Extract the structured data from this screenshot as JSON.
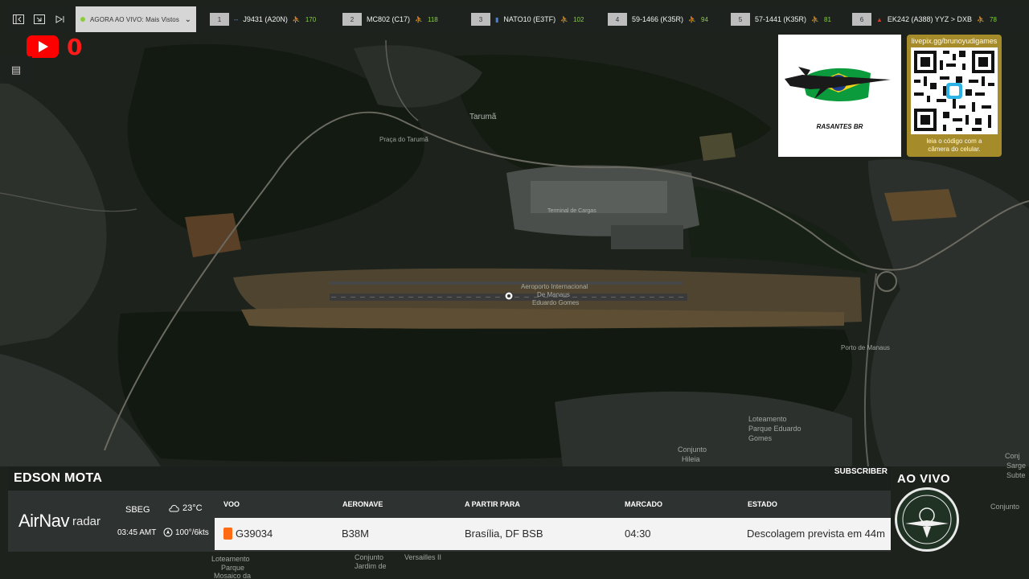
{
  "topbar": {
    "icons": [
      "panel-collapse-icon",
      "picture-in-picture-icon",
      "skip-next-icon"
    ],
    "filter_label": "AGORA AO VIVO: Mais Vistos",
    "filter_icon": "chevron-down-icon",
    "flights": [
      {
        "num": "1",
        "callsign": "J9431 (A20N)",
        "pax": "170",
        "mark": "--",
        "mark_color": "#6f8fc9"
      },
      {
        "num": "2",
        "callsign": "MC802 (C17)",
        "pax": "118",
        "mark": "",
        "mark_color": "#6f8fc9"
      },
      {
        "num": "3",
        "callsign": "NATO10 (E3TF)",
        "pax": "102",
        "mark": "▮",
        "mark_color": "#4a7fd4"
      },
      {
        "num": "4",
        "callsign": "59-1466 (K35R)",
        "pax": "94",
        "mark": "",
        "mark_color": "#6f8fc9"
      },
      {
        "num": "5",
        "callsign": "57-1441 (K35R)",
        "pax": "81",
        "mark": "",
        "mark_color": "#6f8fc9"
      },
      {
        "num": "6",
        "callsign": "EK242 (A388)  YYZ > DXB",
        "pax": "78",
        "mark": "▲",
        "mark_color": "#d9392b"
      }
    ]
  },
  "youtube": {
    "count": "0",
    "icon": "youtube-icon"
  },
  "layers_icon": "layers-icon",
  "logo": {
    "text": "RASANTES BR"
  },
  "qr": {
    "url": "livepix.gg/brunoyudigames",
    "caption_line1": "leia o código com a",
    "caption_line2": "câmera do celular."
  },
  "map": {
    "labels": {
      "taruma": "Tarumã",
      "praca": "Praça do Tarumã",
      "terminal": "Terminal de Cargas",
      "aeroporto_1": "Aeroporto Internacional",
      "aeroporto_2": "De Manaus",
      "aeroporto_3": "Eduardo Gomes",
      "loteamento_1": "Loteamento",
      "loteamento_2": "Parque Eduardo",
      "loteamento_3": "Gomes",
      "conjunto_hileia_1": "Conjunto",
      "conjunto_hileia_2": "Hileia",
      "porto": "Porto de Manaus",
      "conjunto_r": "Conjunto",
      "sargento_1": "Conj",
      "sargento_2": "Sarge",
      "sargento_3": "Subte",
      "versailles": "Versailles II",
      "loteamento_b1": "Loteamento",
      "loteamento_b2": "Parque",
      "loteamento_b3": "Mosaico da",
      "conjunto_b1": "Conjunto",
      "conjunto_b2": "Jardim de"
    }
  },
  "ticker": {
    "name": "EDSON MOTA",
    "subscriber": "SUBSCRIBER",
    "brand_a": "AirNav",
    "brand_b": "radar",
    "airport": "SBEG",
    "local_time": "03:45 AMT",
    "temperature": "23°C",
    "wind": "100°/6kts",
    "headers": {
      "voo": "VOO",
      "aeronave": "AERONAVE",
      "partir": "A PARTIR PARA",
      "marcado": "MARCADO",
      "estado": "ESTADO"
    },
    "row": {
      "voo": "G39034",
      "aeronave": "B38M",
      "partir": "Brasília, DF BSB",
      "marcado": "04:30",
      "estado": "Descolagem prevista em 44m"
    }
  },
  "live": {
    "label": "AO VIVO"
  }
}
